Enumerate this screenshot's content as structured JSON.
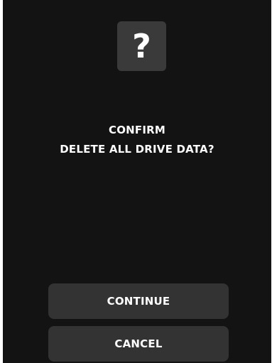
{
  "dialog": {
    "icon": {
      "name": "question-icon",
      "glyph": "?"
    },
    "message_line1": "CONFIRM",
    "message_line2": "DELETE ALL DRIVE DATA?",
    "continue_label": "CONTINUE",
    "cancel_label": "CANCEL"
  },
  "colors": {
    "background": "#131313",
    "icon_background": "#3a3a3a",
    "button_background": "#333333",
    "text": "#ffffff"
  }
}
